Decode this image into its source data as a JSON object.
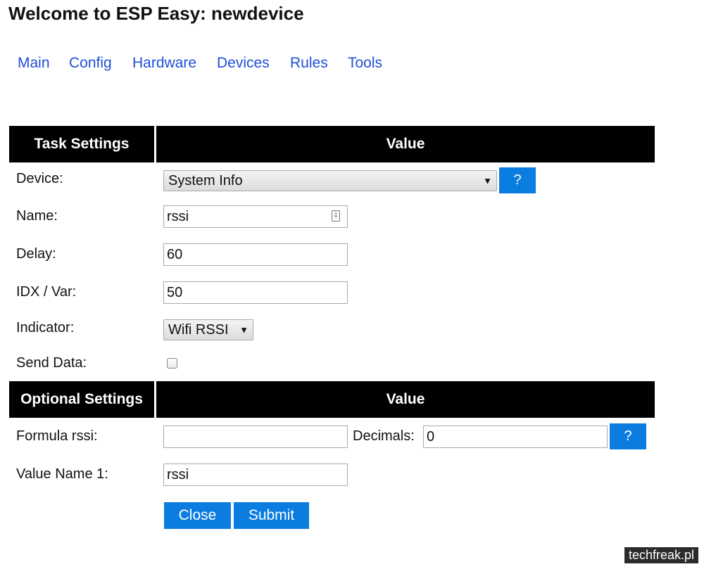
{
  "header": {
    "title": "Welcome to ESP Easy: newdevice"
  },
  "nav": [
    "Main",
    "Config",
    "Hardware",
    "Devices",
    "Rules",
    "Tools"
  ],
  "task_table": {
    "col1": "Task Settings",
    "col2": "Value",
    "device_label": "Device:",
    "device_value": "System Info",
    "help_label": "?",
    "name_label": "Name:",
    "name_value": "rssi",
    "delay_label": "Delay:",
    "delay_value": "60",
    "idx_label": "IDX / Var:",
    "idx_value": "50",
    "indicator_label": "Indicator:",
    "indicator_value": "Wifi RSSI",
    "send_label": "Send Data:",
    "send_checked": false
  },
  "optional_table": {
    "col1": "Optional Settings",
    "col2": "Value",
    "formula_label": "Formula rssi:",
    "formula_value": "",
    "decimals_label": "Decimals:",
    "decimals_value": "0",
    "help_label": "?",
    "valuename_label": "Value Name 1:",
    "valuename_value": "rssi"
  },
  "buttons": {
    "close": "Close",
    "submit": "Submit"
  },
  "watermark": "techfreak.pl",
  "colors": {
    "accent": "#0b7de0",
    "header_bg": "#000000",
    "link": "#1f4fd8"
  }
}
